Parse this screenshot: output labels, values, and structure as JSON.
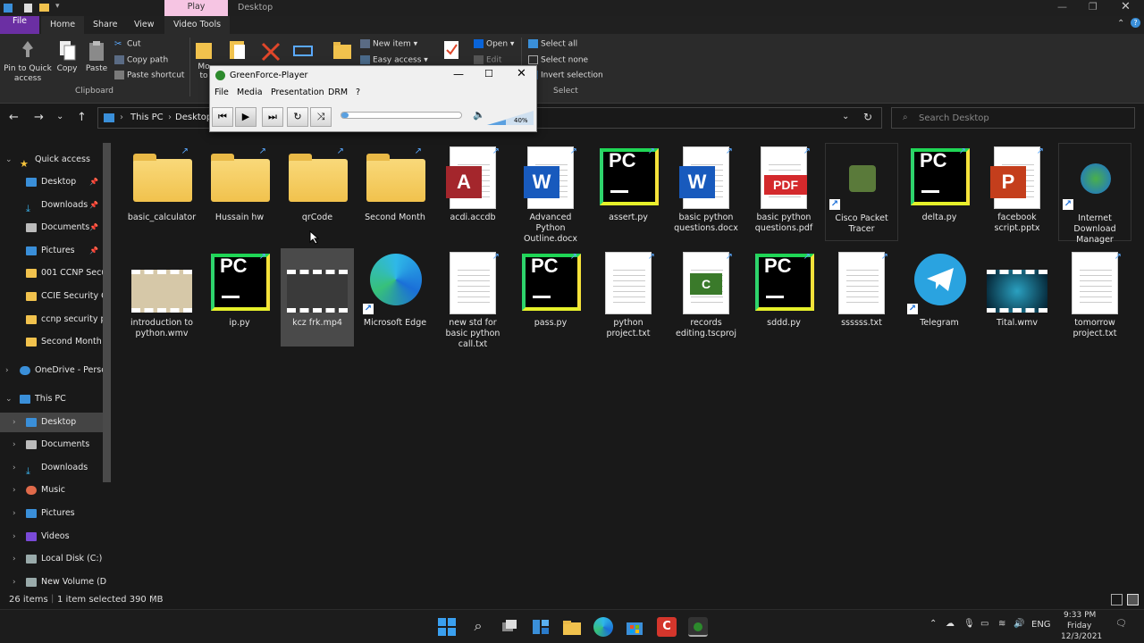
{
  "window": {
    "context_tab": "Play",
    "title": "Desktop"
  },
  "tabs": [
    {
      "label": "File"
    },
    {
      "label": "Home"
    },
    {
      "label": "Share"
    },
    {
      "label": "View"
    },
    {
      "label": "Video Tools"
    }
  ],
  "ribbon": {
    "pin_label": "Pin to Quick access",
    "copy_label": "Copy",
    "paste_label": "Paste",
    "cut_label": "Cut",
    "copy_path_label": "Copy path",
    "paste_shortcut_label": "Paste shortcut",
    "clipboard_group": "Clipboard",
    "move_label": "Mo",
    "move_label2": "to",
    "new_item_label": "New item ▾",
    "easy_access_label": "Easy access ▾",
    "open_label": "Open ▾",
    "edit_label": "Edit",
    "select_all_label": "Select all",
    "select_none_label": "Select none",
    "invert_selection_label": "Invert selection",
    "select_group": "Select"
  },
  "address": {
    "crumbs": [
      "This PC",
      "Desktop"
    ],
    "search_placeholder": "Search Desktop"
  },
  "player": {
    "title": "GreenForce-Player",
    "menu": [
      "File",
      "Media",
      "Presentation",
      "DRM",
      "?"
    ],
    "volume": "40%",
    "progress": 0.03
  },
  "nav": {
    "quick_access": "Quick access",
    "quick_items": [
      "Desktop",
      "Downloads",
      "Documents",
      "Pictures",
      "001 CCNP Secu",
      "CCIE Security C",
      "ccnp security pi",
      "Second Month"
    ],
    "onedrive": "OneDrive - Perso",
    "this_pc": "This PC",
    "pc_items": [
      "Desktop",
      "Documents",
      "Downloads",
      "Music",
      "Pictures",
      "Videos",
      "Local Disk (C:)",
      "New Volume (D"
    ]
  },
  "files": [
    {
      "name": "basic_calculator"
    },
    {
      "name": "Hussain hw"
    },
    {
      "name": "qrCode"
    },
    {
      "name": "Second Month"
    },
    {
      "name": "acdi.accdb"
    },
    {
      "name": "Advanced Python Outline.docx"
    },
    {
      "name": "assert.py"
    },
    {
      "name": "basic python questions.docx"
    },
    {
      "name": "basic python questions.pdf"
    },
    {
      "name": "Cisco Packet Tracer"
    },
    {
      "name": "delta.py"
    },
    {
      "name": "facebook script.pptx"
    },
    {
      "name": "Internet Download Manager"
    },
    {
      "name": "introduction to python.wmv"
    },
    {
      "name": "ip.py"
    },
    {
      "name": "kcz frk.mp4"
    },
    {
      "name": "Microsoft Edge"
    },
    {
      "name": "new std for basic python call.txt"
    },
    {
      "name": "pass.py"
    },
    {
      "name": "python project.txt"
    },
    {
      "name": "records editing.tscproj"
    },
    {
      "name": "sddd.py"
    },
    {
      "name": "ssssss.txt"
    },
    {
      "name": "Telegram"
    },
    {
      "name": "Tital.wmv"
    },
    {
      "name": "tomorrow project.txt"
    }
  ],
  "status": {
    "items": "26 items",
    "selected": "1 item selected  390 MB"
  },
  "taskbar": {
    "time": "9:33 PM",
    "day": "Friday",
    "date": "12/3/2021",
    "lang": "ENG"
  },
  "colors": {
    "file_tab": "#6b2fa3",
    "play_tab": "#f6c5e3",
    "accent": "#0a64d8"
  }
}
